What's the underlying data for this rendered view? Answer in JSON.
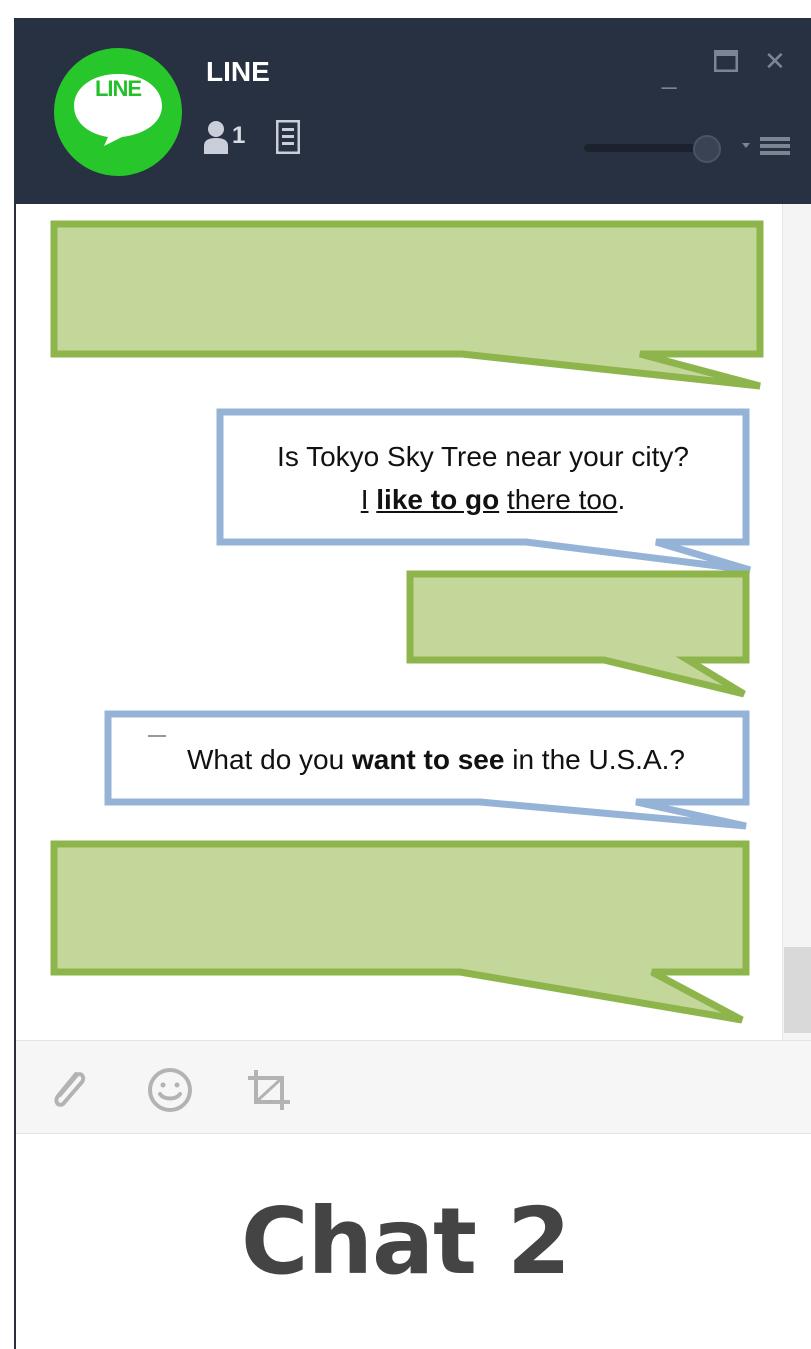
{
  "app": {
    "title": "LINE",
    "logo_text": "LINE",
    "member_count": "1"
  },
  "window": {
    "minimize": "_",
    "close": "✕"
  },
  "messages": [
    {
      "side": "green",
      "text_line1": "",
      "text_line2": ""
    },
    {
      "side": "blue",
      "line1": "Is Tokyo Sky Tree near your city?",
      "line2_a": "I",
      "line2_b": "like to go",
      "line2_c": "there too",
      "line2_d": "."
    },
    {
      "side": "green"
    },
    {
      "side": "blue",
      "line_a": "What do you",
      "line_b": "want to see",
      "line_c": "in the U.S.A.?"
    },
    {
      "side": "green"
    }
  ],
  "toolbar": {
    "attach_icon": "paperclip-icon",
    "emoji_icon": "smiley-icon",
    "capture_icon": "crop-icon"
  },
  "caption": "Chat 2",
  "colors": {
    "titlebar": "#283142",
    "green_fill": "#c4d79b",
    "green_border": "#8db54b",
    "blue_border": "#95b3d7",
    "logo_green": "#27c72b"
  }
}
